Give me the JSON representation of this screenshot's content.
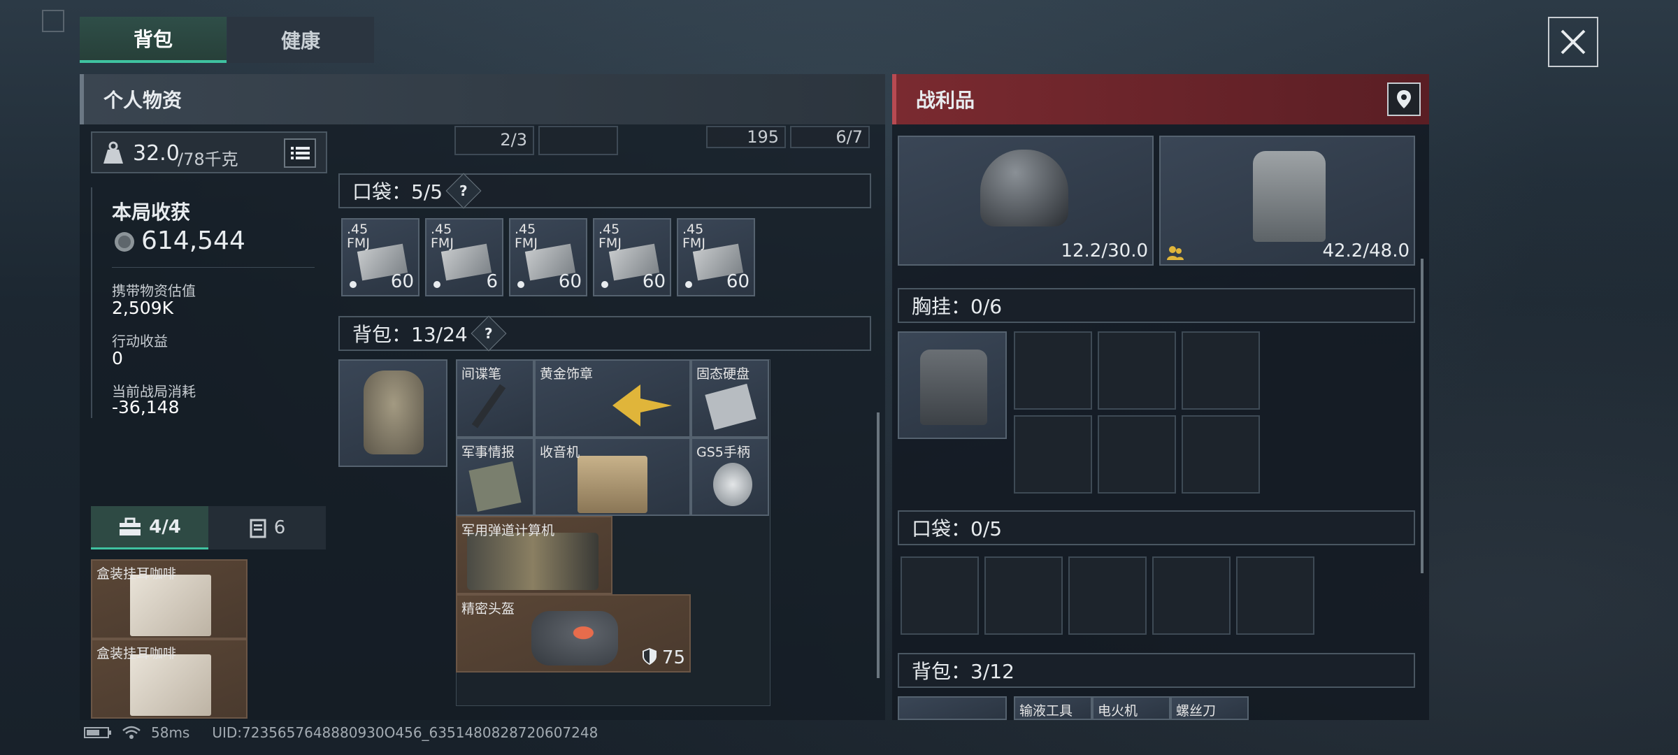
{
  "tabs": [
    "背包",
    "健康"
  ],
  "personal": {
    "title": "个人物资",
    "weight": "32.0",
    "weight_max": "/78千克",
    "haul_title": "本局收获",
    "haul_value": "614,544",
    "carry_label": "携带物资估值",
    "carry_value": "2,509K",
    "action_label": "行动收益",
    "action_value": "0",
    "consume_label": "当前战局消耗",
    "consume_value": "-36,148",
    "tool_count": "4/4",
    "box_count": "6",
    "consumables": [
      "盒装挂耳咖啡",
      "盒装挂耳咖啡"
    ]
  },
  "center": {
    "top_partial": [
      "2/3",
      "195",
      "6/7"
    ],
    "pocket_label": "口袋：5/5",
    "pocket_items": [
      {
        "label": ".45\nFMJ",
        "count": "60"
      },
      {
        "label": ".45\nFMJ",
        "count": "6"
      },
      {
        "label": ".45\nFMJ",
        "count": "60"
      },
      {
        "label": ".45\nFMJ",
        "count": "60"
      },
      {
        "label": ".45\nFMJ",
        "count": "60"
      }
    ],
    "bag_label": "背包：13/24",
    "bag_items": [
      "间谍笔",
      "黄金饰章",
      "固态硬盘",
      "军事情报",
      "收音机",
      "GS5手柄",
      "军用弹道计算机",
      "精密头盔"
    ],
    "helmet_durability": "75"
  },
  "loot": {
    "title": "战利品",
    "helmet_dur": "12.2/30.0",
    "armor_dur": "42.2/48.0",
    "chest_label": "胸挂：0/6",
    "pocket_label": "口袋：0/5",
    "bag_label": "背包：3/12",
    "bag_items": [
      "输液工具",
      "电火机",
      "螺丝刀"
    ]
  },
  "status": {
    "ping": "58ms",
    "uid": "UID:7235657648880930O456_6351480828720607248"
  },
  "colors": {
    "accent": "#3fc2a0",
    "loot_red": "#8a2a30",
    "gold": "#e0b53a"
  }
}
